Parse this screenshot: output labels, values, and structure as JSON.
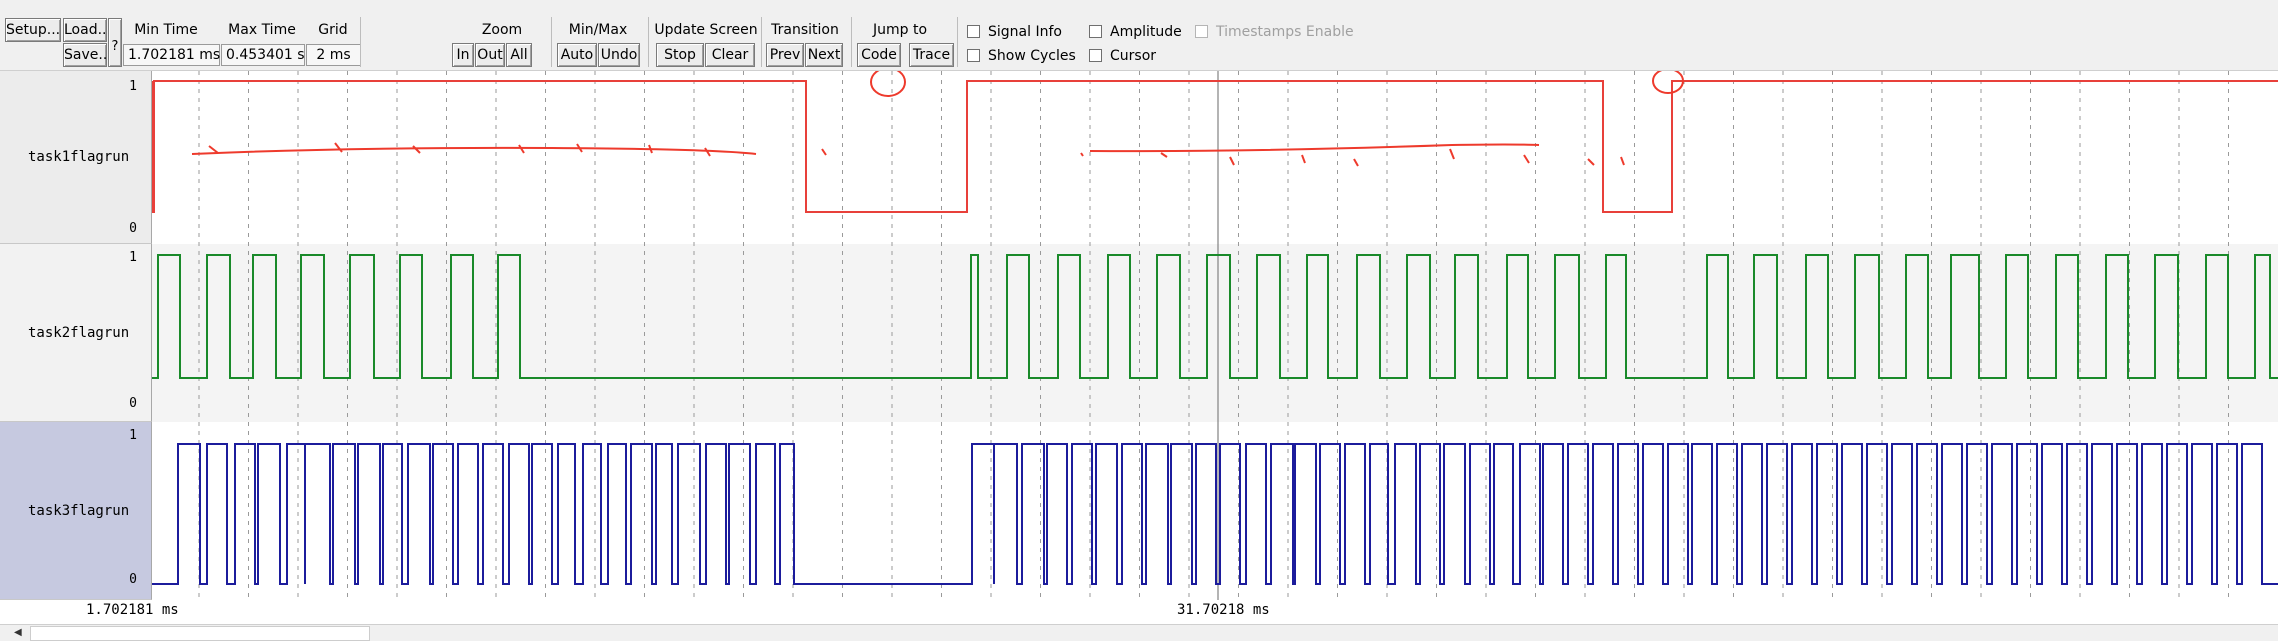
{
  "toolbar": {
    "setup_label": "Setup...",
    "load_label": "Load...",
    "save_label": "Save...",
    "help_label": "?",
    "min_time_label": "Min Time",
    "min_time_value": "1.702181 ms",
    "max_time_label": "Max Time",
    "max_time_value": "0.453401 s",
    "grid_label": "Grid",
    "grid_value": "2 ms",
    "zoom_label": "Zoom",
    "zoom_in": "In",
    "zoom_out": "Out",
    "zoom_all": "All",
    "minmax_label": "Min/Max",
    "minmax_auto": "Auto",
    "minmax_undo": "Undo",
    "update_label": "Update Screen",
    "update_stop": "Stop",
    "update_clear": "Clear",
    "transition_label": "Transition",
    "transition_prev": "Prev",
    "transition_next": "Next",
    "jump_label": "Jump to",
    "jump_code": "Code",
    "jump_trace": "Trace",
    "signal_info": "Signal Info",
    "amplitude": "Amplitude",
    "timestamps": "Timestamps Enable",
    "show_cycles": "Show Cycles",
    "cursor": "Cursor"
  },
  "signals": [
    {
      "name": "task1flagrun",
      "high_label": "1",
      "low_label": "0",
      "color": "#e8403a"
    },
    {
      "name": "task2flagrun",
      "high_label": "1",
      "low_label": "0",
      "color": "#1a8a2a"
    },
    {
      "name": "task3flagrun",
      "high_label": "1",
      "low_label": "0",
      "color": "#1c1c9c"
    }
  ],
  "time_axis": {
    "start_label": "1.702181 ms",
    "mid_label": "31.70218 ms"
  },
  "annotation_color": "#ee3a2c"
}
